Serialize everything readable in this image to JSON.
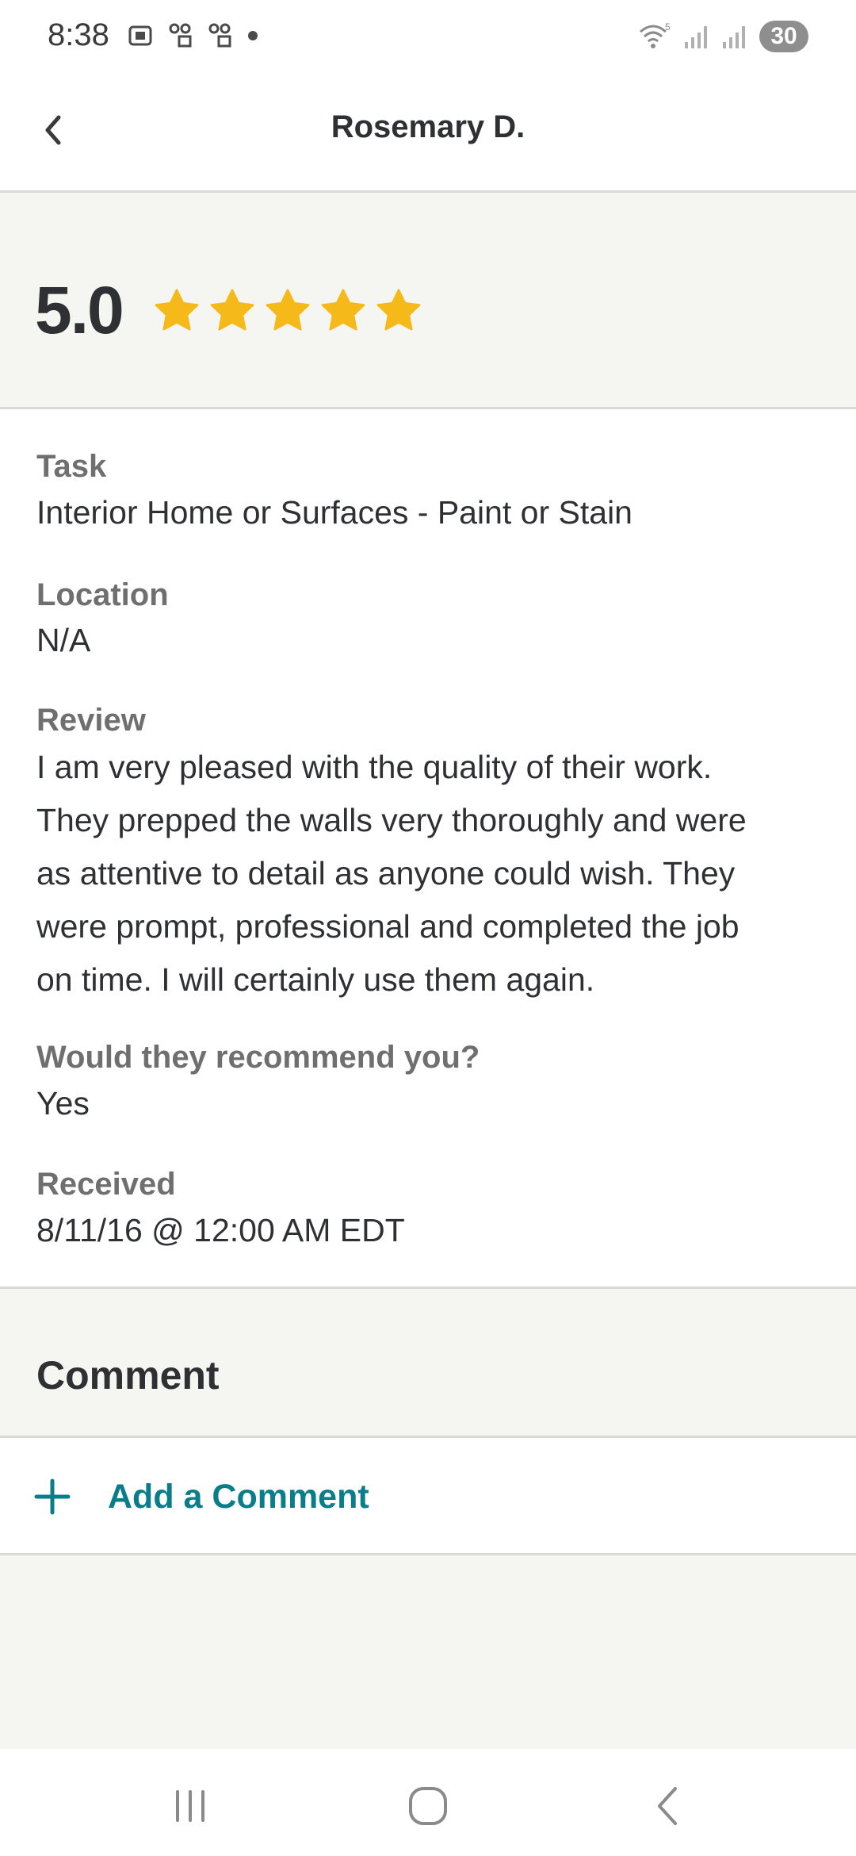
{
  "status_bar": {
    "time": "8:38",
    "battery": "30",
    "wifi_generation": "5"
  },
  "header": {
    "title": "Rosemary D."
  },
  "rating": {
    "value": "5.0",
    "stars": 5,
    "star_color": "#f5b91a"
  },
  "details": {
    "task_label": "Task",
    "task_value": "Interior Home or Surfaces - Paint or Stain",
    "location_label": "Location",
    "location_value": "N/A",
    "review_label": "Review",
    "review_value": "I am very pleased with the quality of their work.\nThey prepped the walls very thoroughly and were\nas attentive to detail as anyone could wish.  They\nwere prompt, professional and completed the job\non time.  I will certainly use them again.",
    "recommend_label": "Would they recommend you?",
    "recommend_value": "Yes",
    "received_label": "Received",
    "received_value": "8/11/16 @ 12:00 AM EDT"
  },
  "comment": {
    "title": "Comment",
    "add_label": "Add a Comment",
    "accent_color": "#0a7d8a"
  },
  "icons": {
    "back": "chevron-left-icon",
    "star": "star-icon",
    "plus": "plus-icon",
    "nav_recents": "recents-icon",
    "nav_home": "home-icon",
    "nav_back": "back-icon"
  }
}
